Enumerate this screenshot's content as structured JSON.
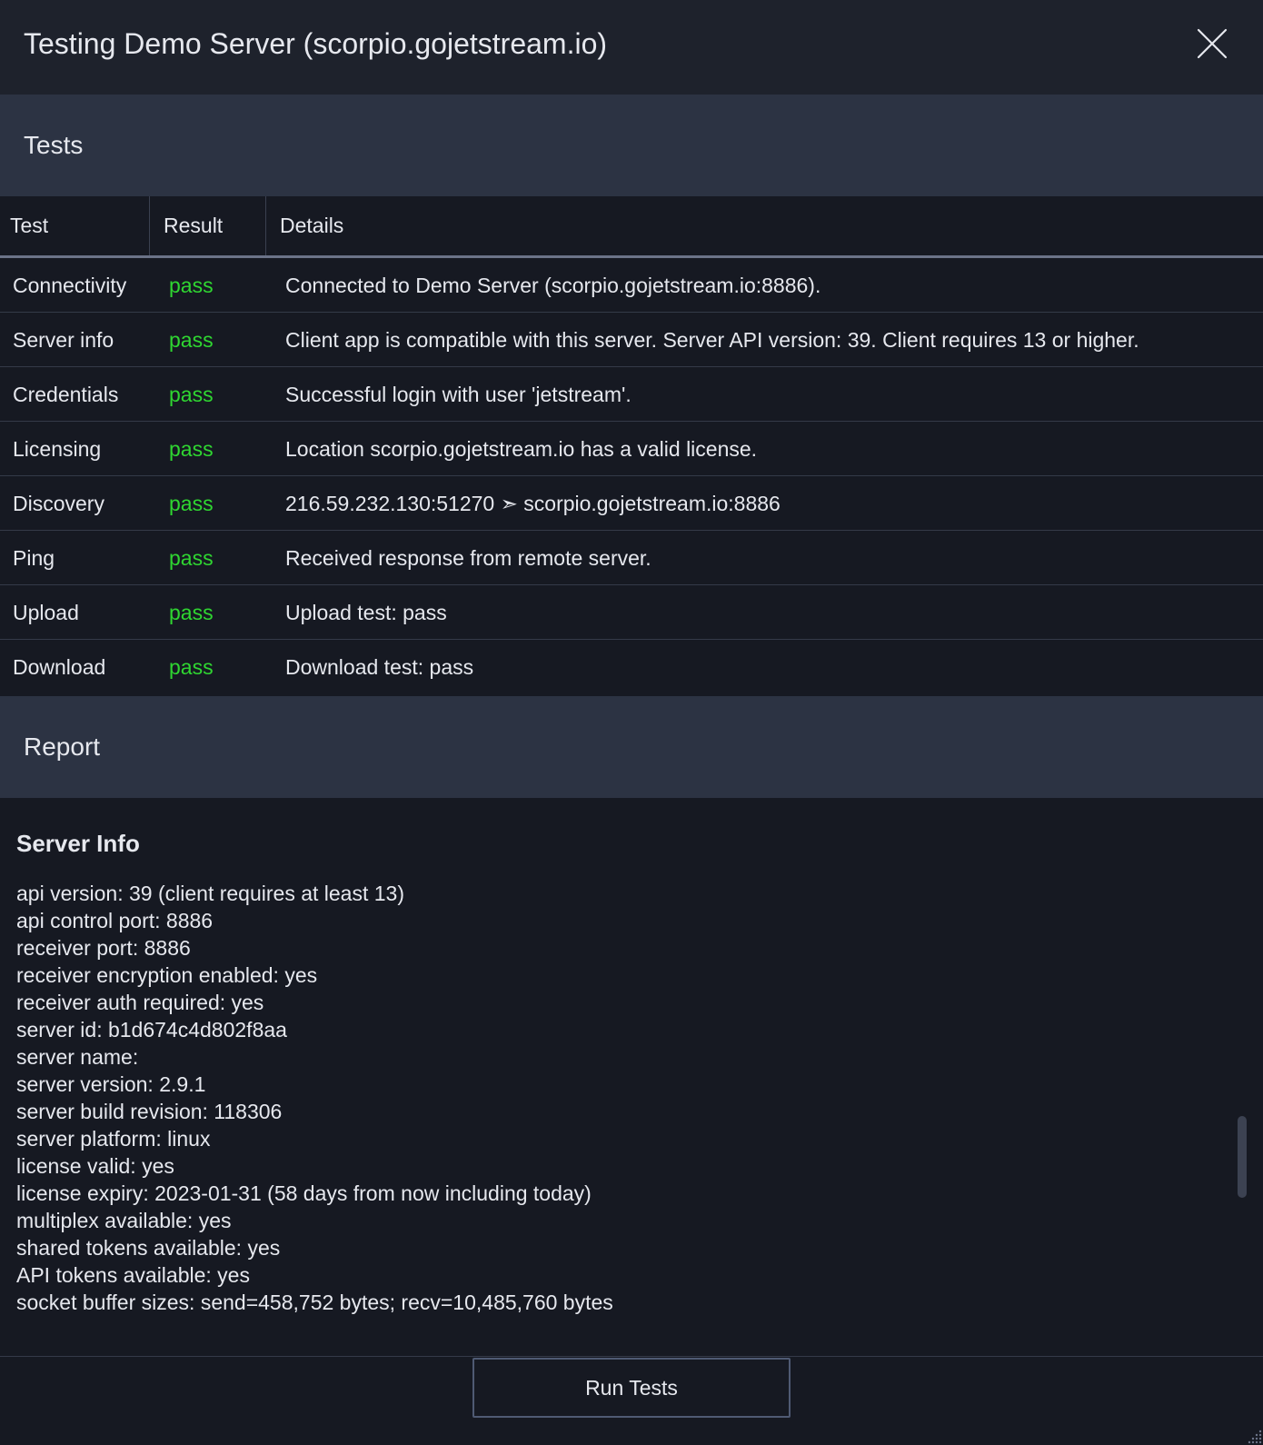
{
  "window": {
    "title": "Testing Demo Server (scorpio.gojetstream.io)"
  },
  "tests_section": {
    "label": "Tests",
    "columns": {
      "test": "Test",
      "result": "Result",
      "details": "Details"
    },
    "rows": [
      {
        "test": "Connectivity",
        "result": "pass",
        "details": "Connected to Demo Server (scorpio.gojetstream.io:8886)."
      },
      {
        "test": "Server info",
        "result": "pass",
        "details": "Client app is compatible with this server. Server API version: 39. Client requires 13 or higher."
      },
      {
        "test": "Credentials",
        "result": "pass",
        "details": "Successful login with user 'jetstream'."
      },
      {
        "test": "Licensing",
        "result": "pass",
        "details": "Location scorpio.gojetstream.io has a valid license."
      },
      {
        "test": "Discovery",
        "result": "pass",
        "details": "216.59.232.130:51270 ➣ scorpio.gojetstream.io:8886"
      },
      {
        "test": "Ping",
        "result": "pass",
        "details": "Received response from remote server."
      },
      {
        "test": "Upload",
        "result": "pass",
        "details": "Upload test: pass"
      },
      {
        "test": "Download",
        "result": "pass",
        "details": "Download test: pass"
      }
    ],
    "pass_color": "#2fd631"
  },
  "report_section": {
    "label": "Report",
    "heading": "Server Info",
    "lines": [
      "api version: 39 (client requires at least 13)",
      "api control port: 8886",
      "receiver port: 8886",
      "receiver encryption enabled: yes",
      "receiver auth required: yes",
      "server id: b1d674c4d802f8aa",
      "server name:",
      "server version: 2.9.1",
      "server build revision: 118306",
      "server platform: linux",
      "license valid: yes",
      "license expiry: 2023-01-31 (58 days from now including today)",
      "multiplex available: yes",
      "shared tokens available: yes",
      "API tokens available: yes",
      "socket buffer sizes: send=458,752 bytes; recv=10,485,760 bytes"
    ]
  },
  "footer": {
    "run_button_label": "Run Tests"
  },
  "icons": {
    "close": "close-icon",
    "resize": "resize-grip-icon"
  },
  "theme": {
    "background": "#161922",
    "titlebar": "#1e222c",
    "section_header": "#2c3343",
    "text": "#e6e8ee",
    "button_border": "#4f5a73"
  }
}
